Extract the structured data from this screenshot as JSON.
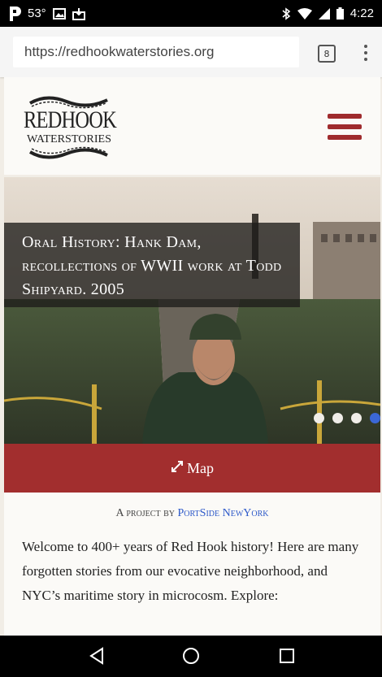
{
  "status_bar": {
    "temperature": "53°",
    "time": "4:22"
  },
  "browser": {
    "url": "https://redhookwaterstories.org",
    "tab_count": "8"
  },
  "site": {
    "logo_line1": "REDHOOK",
    "logo_line2": "WATERSTORIES",
    "hero_caption": "Oral History: Hank Dam, recollections of WWII work at Todd Shipyard. 2005",
    "map_label": "Map",
    "project_prefix": "A project by",
    "project_link": "PortSide NewYork",
    "intro": "Welcome to 400+ years of Red Hook history!  Here are many forgotten stories from our evocative neighborhood, and NYC’s maritime story in microcosm.  Explore:"
  },
  "colors": {
    "accent_red": "#a22e2e",
    "link_blue": "#2c58c9",
    "active_dot": "#3b67d6"
  },
  "slider": {
    "count": 4,
    "active_index": 3
  }
}
